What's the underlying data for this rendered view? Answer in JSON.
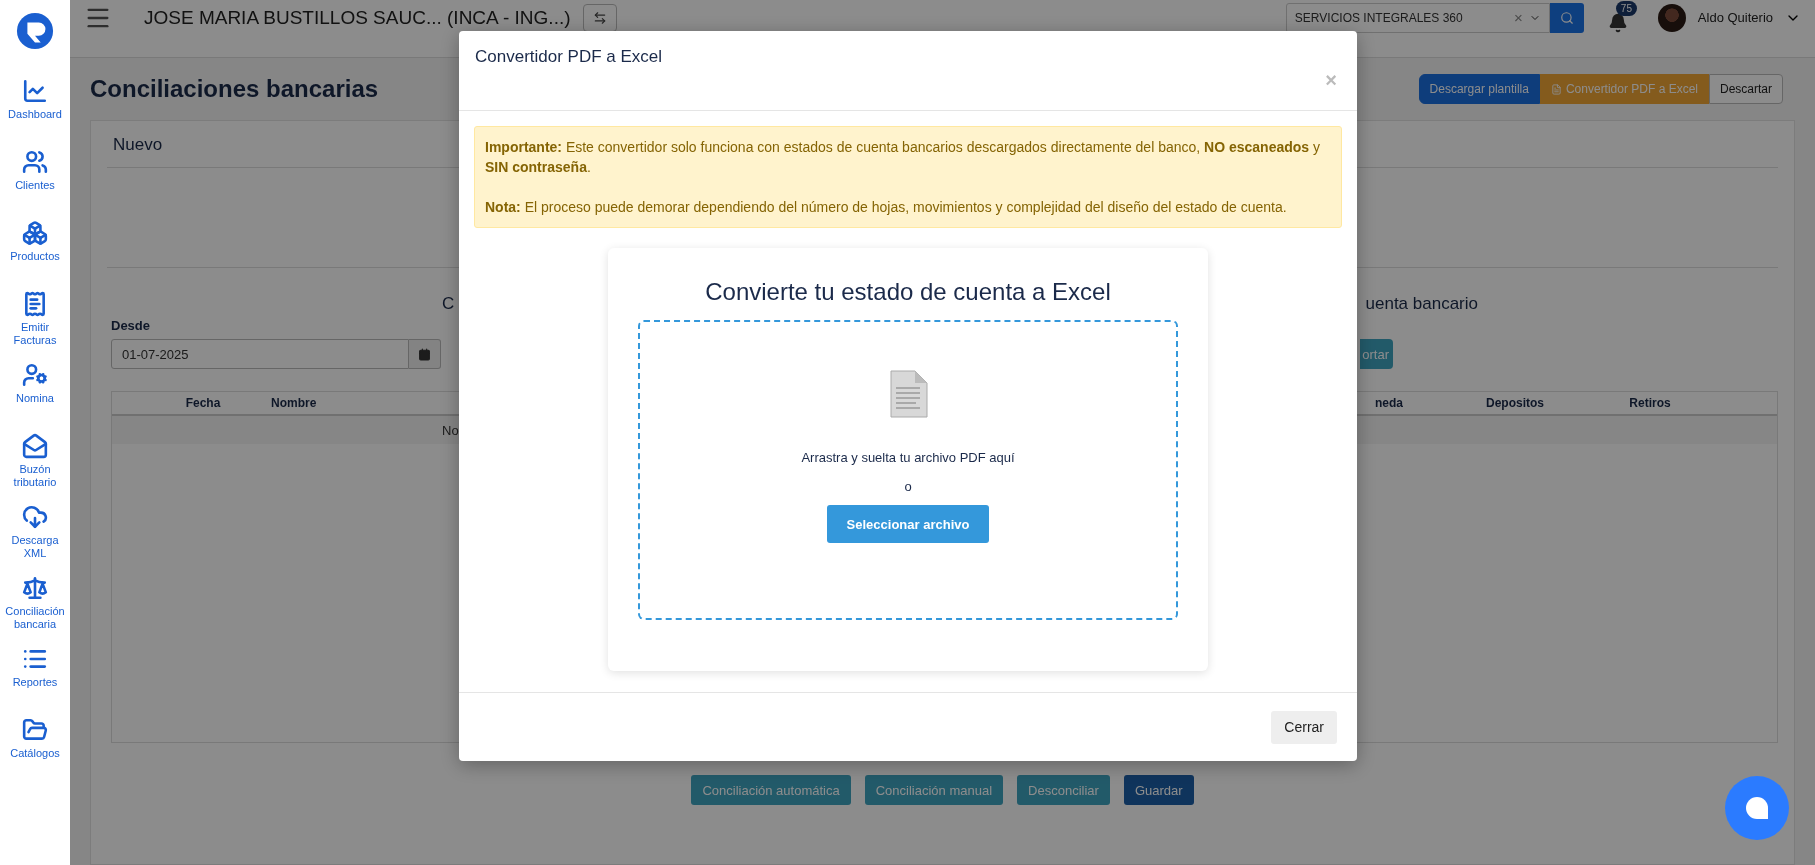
{
  "sidebar": {
    "items": [
      {
        "label": "Dashboard"
      },
      {
        "label": "Clientes"
      },
      {
        "label": "Productos"
      },
      {
        "label": "Emitir Facturas"
      },
      {
        "label": "Nomina"
      },
      {
        "label": "Buzón tributario"
      },
      {
        "label": "Descarga XML"
      },
      {
        "label": "Conciliación bancaria"
      },
      {
        "label": "Reportes"
      },
      {
        "label": "Catálogos"
      }
    ]
  },
  "topbar": {
    "title": "JOSE MARIA BUSTILLOS SAUC... (INCA - ING...)",
    "company_select": {
      "value": "SERVICIOS INTEGRALES 360",
      "clear": "×"
    },
    "notifications": {
      "count": "75"
    },
    "user": {
      "name": "Aldo Quiterio"
    }
  },
  "page": {
    "title": "Conciliaciones bancarias",
    "actions": [
      {
        "label": "Descargar plantilla",
        "kind": "primary"
      },
      {
        "label": "Convertidor PDF a Excel",
        "kind": "warning"
      },
      {
        "label": "Descartar",
        "kind": "light"
      }
    ],
    "section_title": "Nuevo",
    "heading_left": "C",
    "heading_right": "uenta bancario",
    "date_from": {
      "label": "Desde",
      "value": "01-07-2025"
    },
    "import_button": "ortar",
    "table": {
      "columns": [
        "Fecha",
        "Nombre",
        "neda",
        "Depositos",
        "Retiros"
      ],
      "empty_text": "No"
    },
    "footer_buttons": [
      {
        "label": "Conciliación automática",
        "kind": "info"
      },
      {
        "label": "Conciliación manual",
        "kind": "info"
      },
      {
        "label": "Desconciliar",
        "kind": "info"
      },
      {
        "label": "Guardar",
        "kind": "primary"
      }
    ]
  },
  "modal": {
    "title": "Convertidor PDF a Excel",
    "close": "×",
    "notes": [
      "**Importante:** Este convertidor solo funciona con estados de cuenta bancarios descargados directamente del banco, **NO escaneados** y **SIN contraseña**.",
      "**Nota:** El proceso puede demorar dependiendo del número de hojas, movimientos y complejidad del diseño del estado de cuenta."
    ],
    "card_title": "Convierte tu estado de cuenta a Excel",
    "drop_text": "Arrastra y suelta tu archivo PDF aquí",
    "or_text": "o",
    "select_button": "Seleccionar archivo",
    "footer_button": "Cerrar"
  }
}
